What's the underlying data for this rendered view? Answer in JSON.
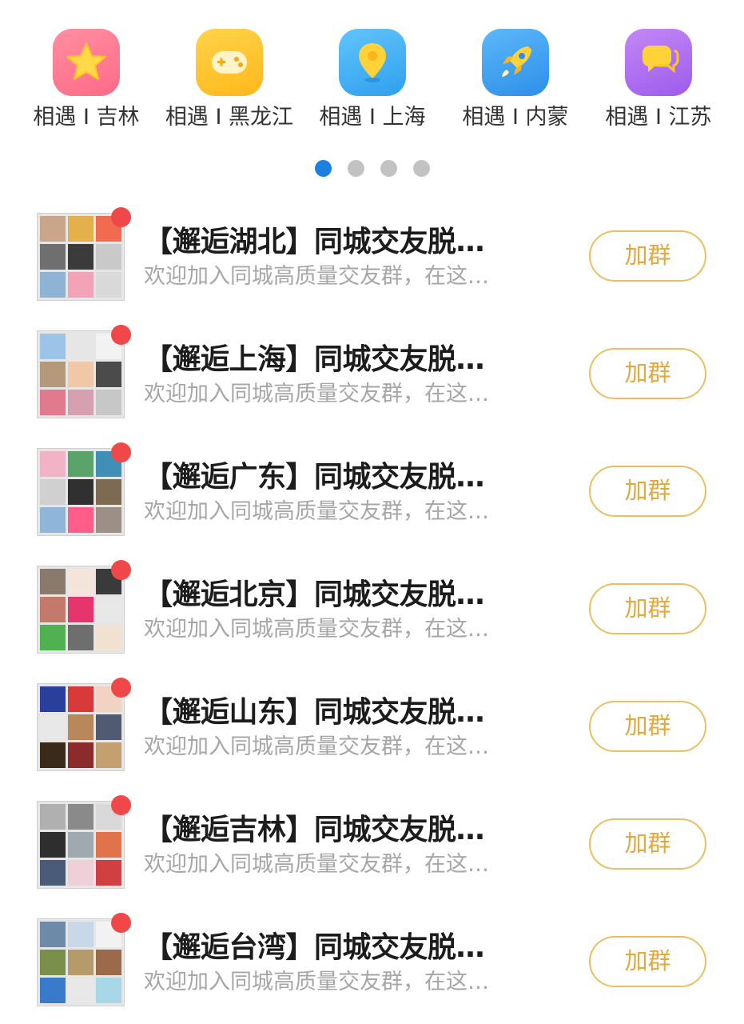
{
  "categories": [
    {
      "label": "相遇 I 吉林",
      "icon": "star-icon",
      "color": "#ff7a93"
    },
    {
      "label": "相遇 I 黑龙江",
      "icon": "gamepad-icon",
      "color": "#ffc52e"
    },
    {
      "label": "相遇 I 上海",
      "icon": "location-pin-icon",
      "color": "#46b2f5"
    },
    {
      "label": "相遇 I 内蒙",
      "icon": "rocket-icon",
      "color": "#3fa2f3"
    },
    {
      "label": "相遇 I 江苏",
      "icon": "chat-bubble-icon",
      "color": "#b572f0"
    }
  ],
  "pager": {
    "total": 4,
    "active": 0,
    "active_color": "#1e7fe0"
  },
  "groups": [
    {
      "title": "【邂逅湖北】同城交友脱…",
      "desc": "欢迎加入同城高质量交友群，在这…",
      "button": "加群"
    },
    {
      "title": "【邂逅上海】同城交友脱…",
      "desc": "欢迎加入同城高质量交友群，在这…",
      "button": "加群"
    },
    {
      "title": "【邂逅广东】同城交友脱…",
      "desc": "欢迎加入同城高质量交友群，在这…",
      "button": "加群"
    },
    {
      "title": "【邂逅北京】同城交友脱…",
      "desc": "欢迎加入同城高质量交友群，在这…",
      "button": "加群"
    },
    {
      "title": "【邂逅山东】同城交友脱…",
      "desc": "欢迎加入同城高质量交友群，在这…",
      "button": "加群"
    },
    {
      "title": "【邂逅吉林】同城交友脱…",
      "desc": "欢迎加入同城高质量交友群，在这…",
      "button": "加群"
    },
    {
      "title": "【邂逅台湾】同城交友脱…",
      "desc": "欢迎加入同城高质量交友群，在这…",
      "button": "加群"
    }
  ],
  "colors": {
    "accent_gold": "#e9bf62",
    "unread_dot": "#f04848"
  }
}
